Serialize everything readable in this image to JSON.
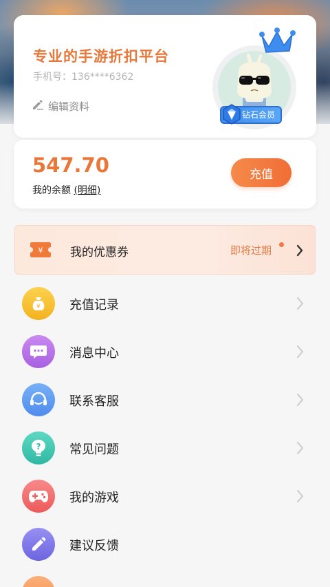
{
  "profile": {
    "slogan": "专业的手游折扣平台",
    "phone": "手机号：136****6362",
    "edit_label": "编辑资料",
    "vip_level": "钻石会员"
  },
  "balance": {
    "amount": "547.70",
    "label": "我的余额",
    "detail_link": "(明细)",
    "recharge_button": "充值"
  },
  "coupon": {
    "title": "我的优惠券",
    "status": "即将过期"
  },
  "menu": {
    "items": [
      {
        "label": "充值记录",
        "icon": "money-bag-icon",
        "color": "#f7c234"
      },
      {
        "label": "消息中心",
        "icon": "message-icon",
        "color": "#b877e6"
      },
      {
        "label": "联系客服",
        "icon": "headset-icon",
        "color": "#5c9bf0"
      },
      {
        "label": "常见问题",
        "icon": "question-icon",
        "color": "#35c6b0"
      },
      {
        "label": "我的游戏",
        "icon": "gamepad-icon",
        "color": "#f06a6a"
      },
      {
        "label": "建议反馈",
        "icon": "pencil-icon",
        "color": "#7b74e6"
      }
    ]
  },
  "colors": {
    "accent": "#e8783a",
    "recharge_gradient": [
      "#f58a4a",
      "#f06e36"
    ],
    "vip_blue": "#3a8ef0"
  }
}
